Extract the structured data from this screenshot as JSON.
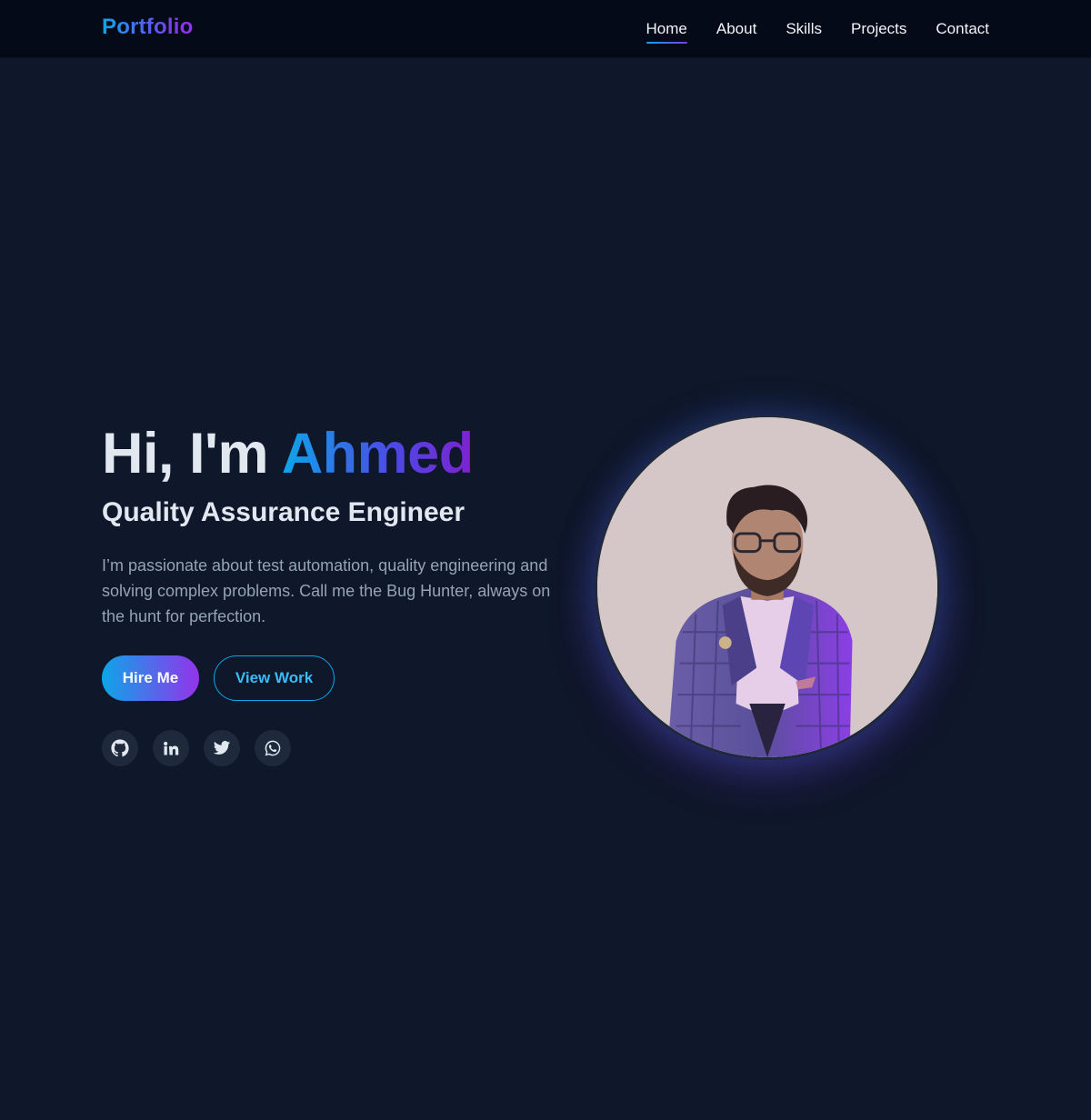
{
  "nav": {
    "brand": "Portfolio",
    "links": [
      "Home",
      "About",
      "Skills",
      "Projects",
      "Contact"
    ],
    "active": "Home"
  },
  "hero": {
    "greeting": "Hi, I'm ",
    "name": "Ahmed",
    "subtitle": "Quality Assurance Engineer",
    "description": "I’m passionate about test automation, quality engineering and solving complex problems. Call me the Bug Hunter, always on the hunt for perfection.",
    "buttons": {
      "primary": "Hire Me",
      "secondary": "View Work"
    },
    "socials": [
      "github-icon",
      "linkedin-icon",
      "twitter-icon",
      "whatsapp-icon"
    ]
  },
  "colors": {
    "background": "#0f172a",
    "navbar": "#050a18",
    "accent_start": "#0ea5e9",
    "accent_end": "#9333ea"
  }
}
